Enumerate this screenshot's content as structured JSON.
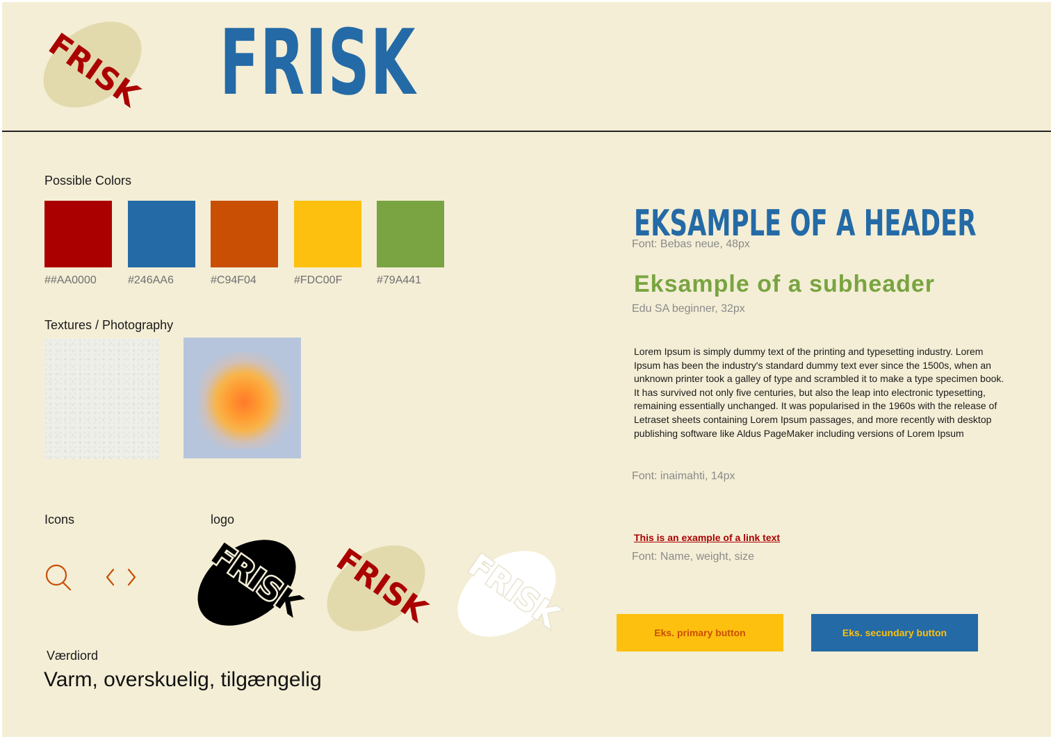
{
  "brand": {
    "name": "FRISK",
    "logo_text": "FRISK"
  },
  "colors_section": {
    "title": "Possible Colors",
    "swatches": [
      {
        "label": "##AA0000",
        "color": "#aa0000"
      },
      {
        "label": "#246AA6",
        "color": "#246aa6"
      },
      {
        "label": "#C94F04",
        "color": "#c94f04"
      },
      {
        "label": "#FDC00F",
        "color": "#fdc00f"
      },
      {
        "label": "#79A441",
        "color": "#79a441"
      }
    ]
  },
  "textures_section": {
    "title": "Textures / Photography"
  },
  "icons_section": {
    "title": "Icons"
  },
  "logo_section": {
    "title": "logo"
  },
  "values_section": {
    "title": "Værdiord",
    "text": "Varm, overskuelig, tilgængelig"
  },
  "typography": {
    "header_example": "EKSAMPLE OF A HEADER",
    "header_meta": "Font: Bebas neue, 48px",
    "subheader_example": "Eksample of a subheader",
    "subheader_meta": "Edu SA beginner, 32px",
    "body_example": "Lorem Ipsum is simply dummy text of the printing and typesetting industry. Lorem Ipsum has been the industry's standard dummy text ever since the 1500s, when an unknown printer took a galley of type and scrambled it to make a type specimen book. It has survived not only five centuries, but also the leap into electronic typesetting, remaining essentially unchanged. It was popularised in the 1960s with the release of Letraset sheets containing Lorem Ipsum passages, and more recently with desktop publishing software like Aldus PageMaker including versions of Lorem Ipsum",
    "body_meta": "Font: inaimahti, 14px",
    "link_example": "This is an example of a link text",
    "link_meta": "Font: Name, weight, size"
  },
  "buttons": {
    "primary_label": "Eks. primary button",
    "secondary_label": "Eks. secundary  button"
  },
  "icons": {
    "search": "search-icon",
    "chevrons": "chevron-left-right-icon"
  },
  "logo_variants": {
    "beige": "#e2d9ad",
    "red": "#aa0000",
    "black": "#000000",
    "white": "#ffffff"
  }
}
